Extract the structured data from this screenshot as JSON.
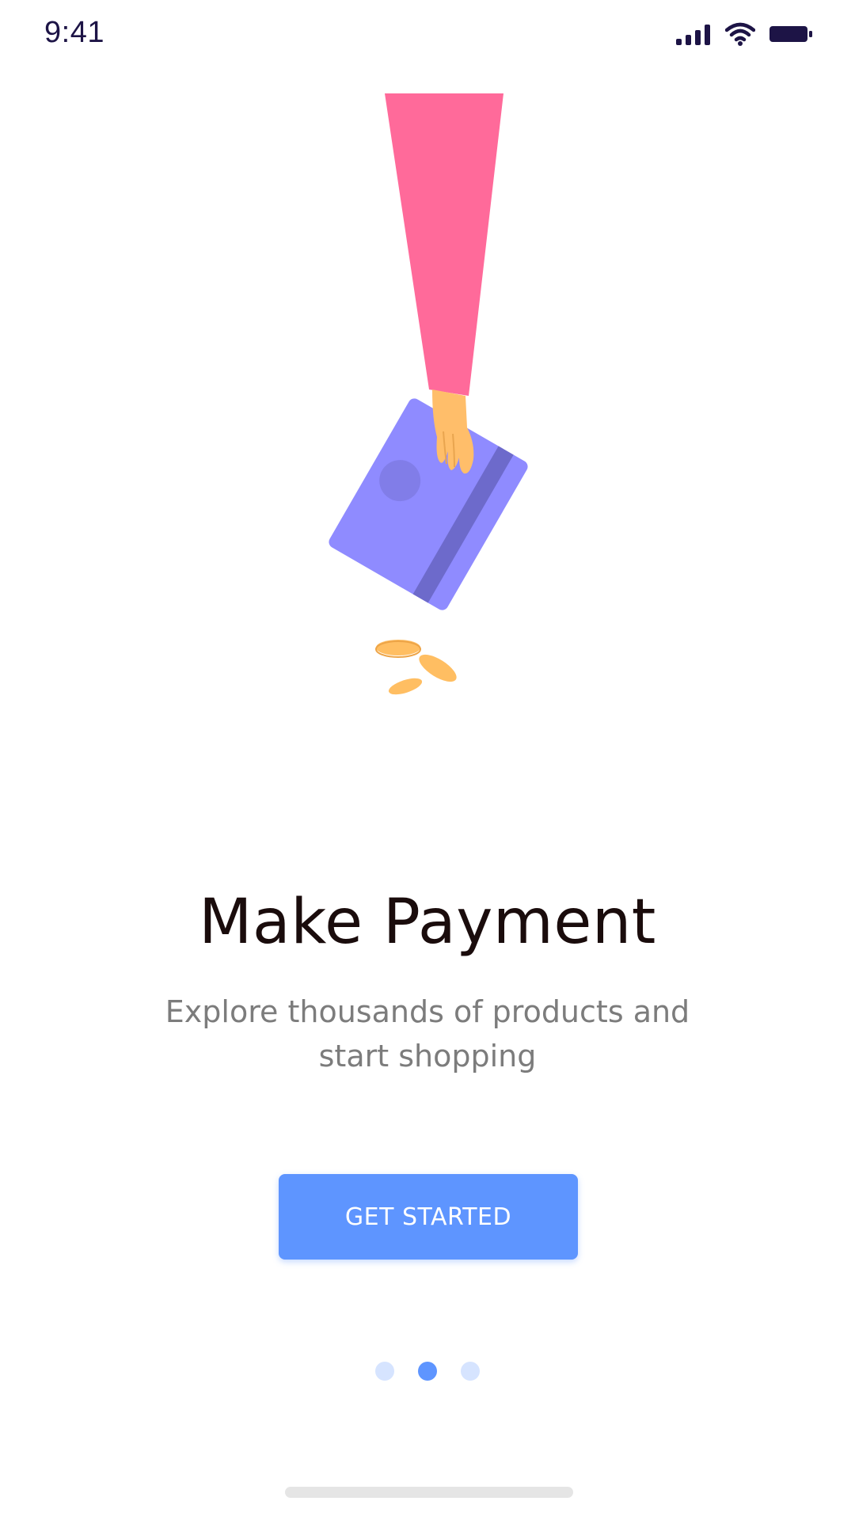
{
  "status_bar": {
    "time": "9:41",
    "icons": [
      "signal-icon",
      "wifi-icon",
      "battery-icon"
    ]
  },
  "illustration": {
    "description_icon": "hand-holding-card-icon",
    "colors": {
      "sleeve": "#ff6a9a",
      "hand": "#ffbe6a",
      "card": "#8f8bff",
      "card_stripe": "#6d6acb",
      "coin": "#ffbe62"
    }
  },
  "onboarding": {
    "title": "Make Payment",
    "subtitle": "Explore thousands of products and start shopping",
    "cta_label": "GET STARTED",
    "pagination": {
      "total": 3,
      "active_index": 1
    }
  },
  "colors": {
    "accent": "#5e95ff",
    "title": "#1a0c0c",
    "subtitle": "#7c7c7c",
    "dot_inactive": "#d6e4ff"
  }
}
